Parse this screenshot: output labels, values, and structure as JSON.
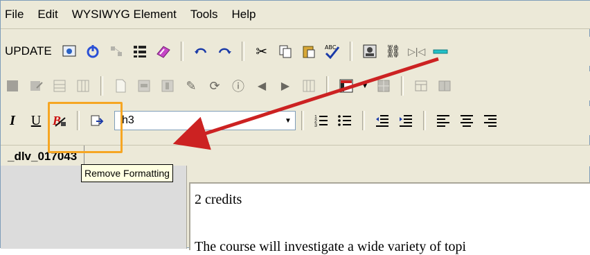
{
  "menu": {
    "items": [
      {
        "label": "File"
      },
      {
        "label": "Edit"
      },
      {
        "label": "WYSIWYG Element"
      },
      {
        "label": "Tools"
      },
      {
        "label": "Help"
      }
    ]
  },
  "toolbar": {
    "update_label": "UPDATE",
    "style_value": "h3"
  },
  "tab": {
    "label": "_dlv_017043"
  },
  "tooltip": {
    "text": "Remove Formatting"
  },
  "editor": {
    "line1": "2 credits",
    "line2": "The course will investigate a wide variety of topi"
  },
  "colors": {
    "highlight": "#f6a623",
    "arrow": "#cc2222"
  }
}
